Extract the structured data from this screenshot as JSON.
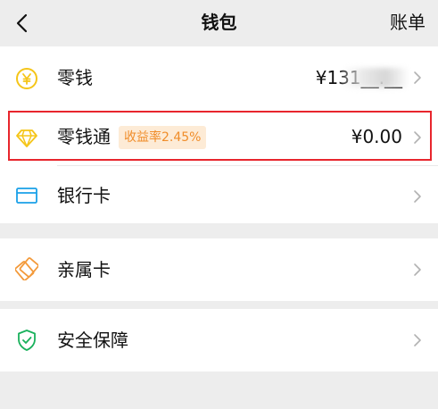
{
  "header": {
    "back_icon": "chevron-left-icon",
    "title": "钱包",
    "right_label": "账单"
  },
  "rows": [
    {
      "label": "零钱",
      "value": "¥131__.__",
      "icon": "yuan-coin-icon",
      "icon_color": "#f5c518"
    },
    {
      "label": "零钱通",
      "badge": "收益率2.45%",
      "value": "¥0.00",
      "icon": "diamond-icon",
      "icon_color": "#f5c518"
    },
    {
      "label": "银行卡",
      "icon": "bank-card-icon",
      "icon_color": "#1aa0e8"
    },
    {
      "label": "亲属卡",
      "icon": "family-card-icon",
      "icon_color": "#f39a3b"
    },
    {
      "label": "安全保障",
      "icon": "shield-check-icon",
      "icon_color": "#19b15c"
    }
  ],
  "colors": {
    "background": "#ededed",
    "card": "#ffffff",
    "highlight_border": "#e8262d",
    "badge_bg": "#fdebd6",
    "badge_text": "#f08d2a",
    "chevron": "#b2b2b2"
  }
}
